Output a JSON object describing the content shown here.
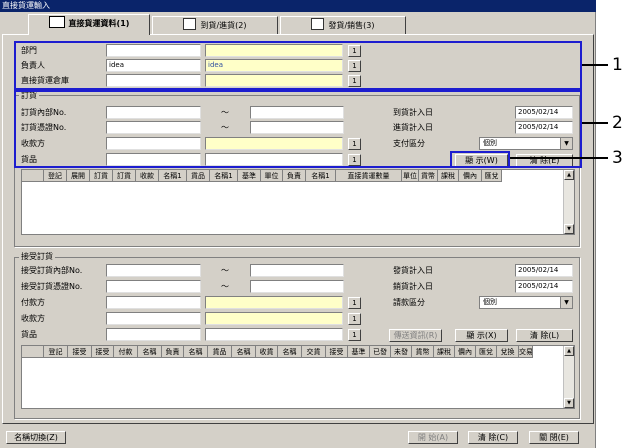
{
  "window": {
    "title": "直接貨運輸入"
  },
  "tabs": [
    {
      "label": "直接貨運資料(1)"
    },
    {
      "label": "到貨/進貨(2)"
    },
    {
      "label": "發貨/銷售(3)"
    }
  ],
  "top": {
    "dept_label": "部門",
    "person_label": "負責人",
    "person_code": "idea",
    "person_name": "idea",
    "warehouse_label": "直接貨運倉庫",
    "lookup": "1"
  },
  "order": {
    "section": "訂貨",
    "internal_no_label": "訂貨內部No.",
    "slip_no_label": "訂貨憑證No.",
    "payee_label": "收款方",
    "goods_label": "貨品",
    "tilde": "～",
    "arrival_date_label": "到貨計入日",
    "arrival_date": "2005/02/14",
    "stock_date_label": "進貨計入日",
    "stock_date": "2005/02/14",
    "payment_label": "支付區分",
    "payment_value": "個別",
    "show_button": "顯 示(W)",
    "clear_button": "清 除(E)",
    "columns": [
      "",
      "登記",
      "展開",
      "訂貨",
      "訂貨",
      "收款",
      "名稱1",
      "貨品",
      "名稱1",
      "基準",
      "單位",
      "負責",
      "名稱1",
      "直接貨運數量",
      "單位",
      "貨幣",
      "課稅",
      "價內",
      "匯兌"
    ]
  },
  "receive": {
    "section": "接受訂貨",
    "internal_no_label": "接受訂貨內部No.",
    "slip_no_label": "接受訂貨憑證No.",
    "payer_label": "付款方",
    "payee_label": "收款方",
    "goods_label": "貨品",
    "tilde": "～",
    "ship_date_label": "發貨計入日",
    "ship_date": "2005/02/14",
    "sales_date_label": "銷貨計入日",
    "sales_date": "2005/02/14",
    "billing_label": "請款區分",
    "billing_value": "個別",
    "detail_button": "傳送資訊(R)",
    "show_button": "顯 示(X)",
    "clear_button": "清 除(L)",
    "columns": [
      "",
      "登記",
      "接受",
      "接受",
      "付款",
      "名稱",
      "負責",
      "名稱",
      "貨品",
      "名稱",
      "收貨",
      "名稱",
      "交貨",
      "接受",
      "基準",
      "已發",
      "未發",
      "貨幣",
      "課稅",
      "價內",
      "匯兌",
      "兌換",
      "交易"
    ]
  },
  "footer": {
    "name_switch": "名稱切換(Z)",
    "start": "開 始(A)",
    "clear": "清 除(C)",
    "close": "關 閉(E)"
  },
  "callouts": [
    "1",
    "2",
    "3"
  ]
}
